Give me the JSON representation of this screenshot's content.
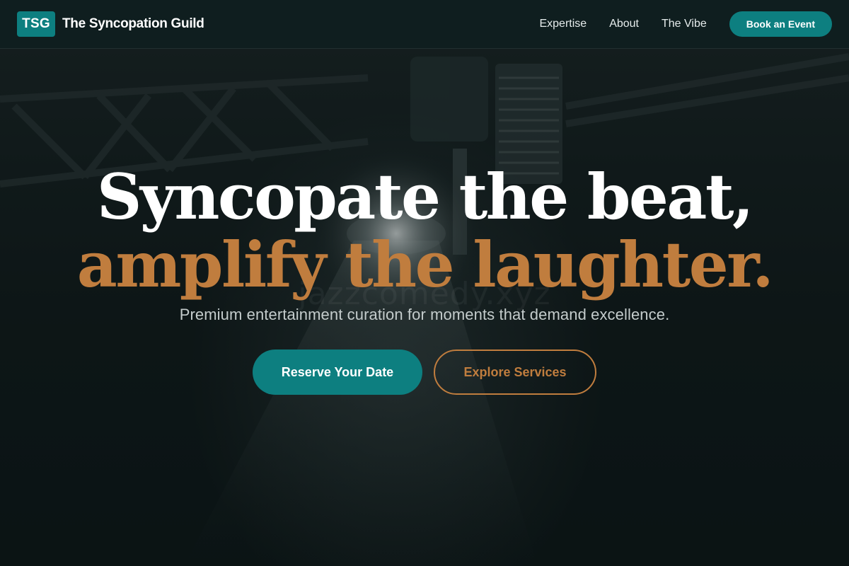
{
  "nav": {
    "logo_mark": "TSG",
    "brand_name": "The Syncopation Guild",
    "links": [
      "Expertise",
      "About",
      "The Vibe"
    ],
    "cta_label": "Book an Event"
  },
  "hero": {
    "headline_line1": "Syncopate the beat,",
    "headline_line2": "amplify the laughter.",
    "subtitle": "Premium entertainment curation for moments that demand excellence.",
    "primary_cta": "Reserve Your Date",
    "secondary_cta": "Explore Services",
    "watermark": "jazzcomedy.xyz"
  },
  "colors": {
    "teal": "#0d7f80",
    "copper": "#c07d3e",
    "background": "#0c1516"
  }
}
